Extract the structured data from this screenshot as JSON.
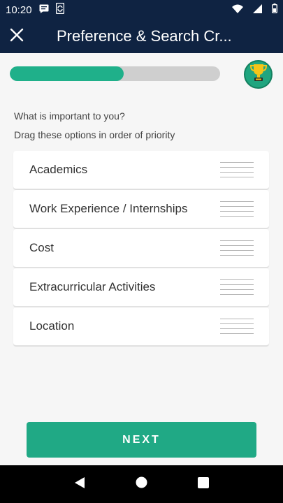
{
  "status_bar": {
    "time": "10:20",
    "left_icons": [
      "message-icon",
      "sync-icon"
    ],
    "right_icons": [
      "wifi-icon",
      "signal-icon",
      "battery-icon"
    ]
  },
  "app_bar": {
    "title": "Preference & Search Cr...",
    "close_icon": "close-icon"
  },
  "progress": {
    "fraction": 0.54,
    "fill_color": "#1fb08a",
    "track_color": "#cfcfcf",
    "badge_icon": "trophy-icon"
  },
  "content": {
    "question": "What is important to you?",
    "instruction": "Drag these options in order of priority"
  },
  "options": [
    {
      "label": "Academics"
    },
    {
      "label": "Work Experience / Internships"
    },
    {
      "label": "Cost"
    },
    {
      "label": "Extracurricular Activities"
    },
    {
      "label": "Location"
    }
  ],
  "next_button": {
    "label": "NEXT",
    "color": "#20a985"
  },
  "nav_bar": {
    "buttons": [
      "back-icon",
      "home-icon",
      "recents-icon"
    ]
  },
  "colors": {
    "header": "#0f2342",
    "background": "#f6f6f6"
  }
}
